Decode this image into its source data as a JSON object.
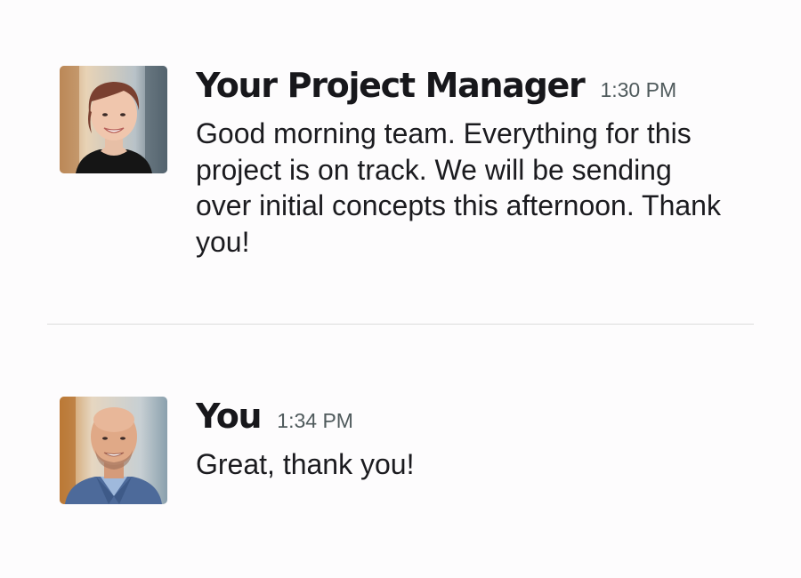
{
  "messages": [
    {
      "sender": "Your Project Manager",
      "time": "1:30 PM",
      "text": "Good morning team. Everything for this project is on track. We will be sending over initial concepts this afternoon. Thank you!",
      "avatar_icon": "woman-portrait-avatar"
    },
    {
      "sender": "You",
      "time": "1:34 PM",
      "text": "Great, thank you!",
      "avatar_icon": "man-portrait-avatar"
    }
  ],
  "colors": {
    "background": "#fdfcfd",
    "sender_text": "#17171b",
    "timestamp": "#4f5a5c",
    "divider": "#dcdcdc"
  }
}
